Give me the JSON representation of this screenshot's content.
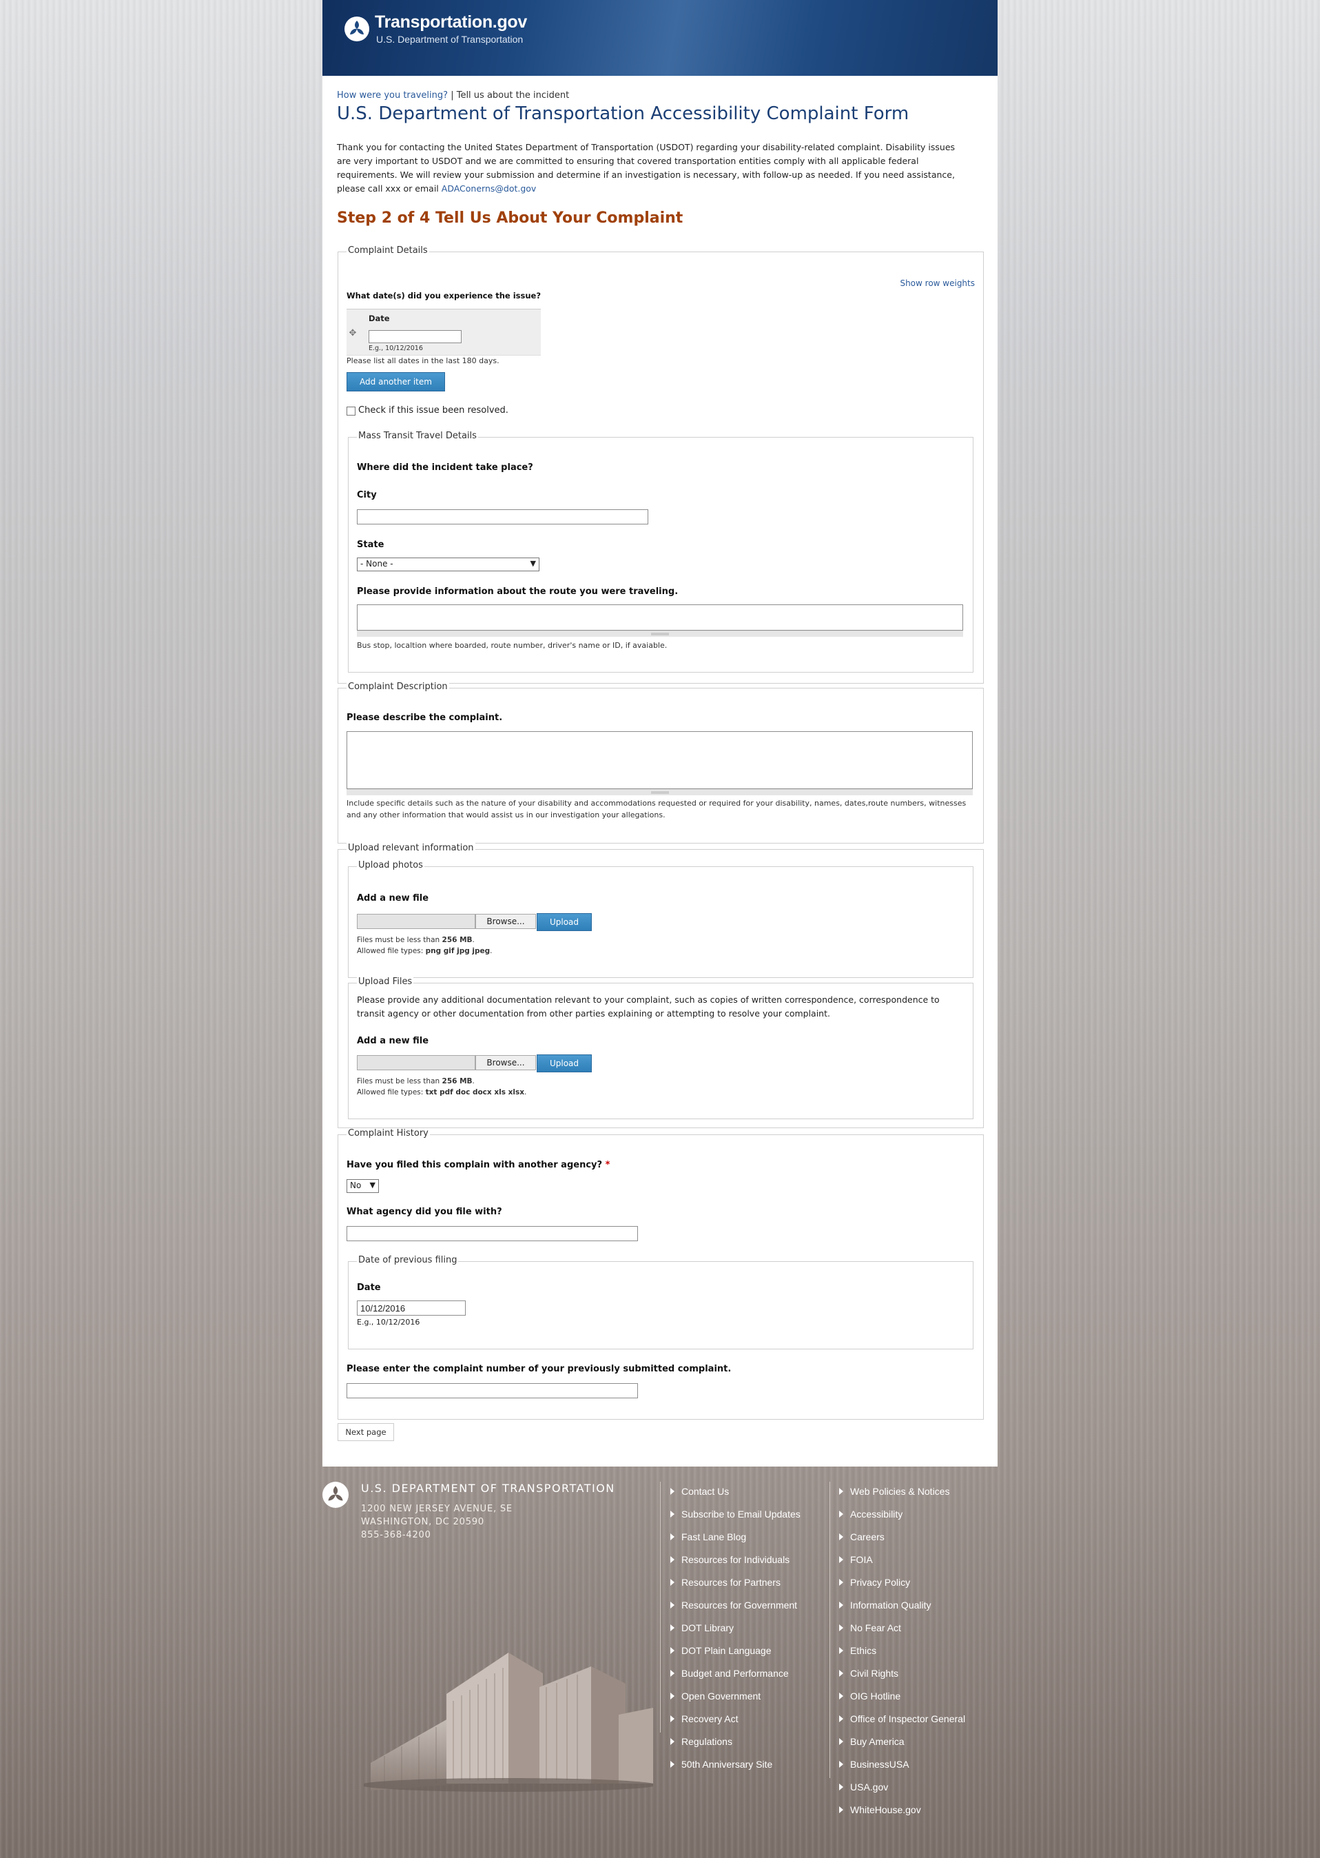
{
  "header": {
    "site_name": "Transportation.gov",
    "site_sub": "U.S. Department of Transportation"
  },
  "breadcrumb": {
    "link": "How were you traveling?",
    "separator": "|",
    "current": "Tell us about the incident"
  },
  "page_title": "U.S. Department of Transportation Accessibility Complaint Form",
  "intro": {
    "text": "Thank you for contacting the United States Department of Transportation (USDOT) regarding your disability-related complaint. Disability issues are very important to USDOT and we are committed to ensuring that covered transportation entities comply with all applicable federal requirements. We will review your submission and determine if an investigation is necessary, with follow-up as needed. If you need assistance, please call xxx or email ",
    "email": "ADAConerns@dot.gov"
  },
  "step_title": "Step 2 of 4 Tell Us About Your Complaint",
  "complaint_details": {
    "legend": "Complaint Details",
    "row_weights_link": "Show row weights",
    "dates_question": "What date(s) did you experience the issue?",
    "date_column": "Date",
    "date_value": "",
    "date_example": "E.g., 10/12/2016",
    "dates_hint": "Please list all dates in the last 180 days.",
    "add_another": "Add another item",
    "resolved_label": "Check if this issue been resolved.",
    "resolved_checked": false,
    "mass_transit": {
      "legend": "Mass Transit Travel Details",
      "where_question": "Where did the incident take place?",
      "city_label": "City",
      "city_value": "",
      "state_label": "State",
      "state_value": "- None -",
      "route_label": "Please provide information about the route you were traveling.",
      "route_value": "",
      "route_hint": "Bus stop, localtion where boarded, route number, driver's name or ID, if avaiable."
    }
  },
  "complaint_description": {
    "legend": "Complaint Description",
    "label": "Please describe the complaint.",
    "value": "",
    "hint": "Include specific details such as the nature of your disability and accommodations requested or required for your disability, names, dates,route numbers, witnesses and any other information that would assist us in our investigation your allegations."
  },
  "upload": {
    "legend": "Upload relevant information",
    "photos": {
      "legend": "Upload photos",
      "add_label": "Add a new file",
      "browse": "Browse...",
      "upload": "Upload",
      "size_prefix": "Files must be less than ",
      "size_value": "256 MB",
      "size_suffix": ".",
      "types_prefix": "Allowed file types: ",
      "types_value": "png gif jpg jpeg",
      "types_suffix": "."
    },
    "files": {
      "legend": "Upload Files",
      "description": "Please provide any additional documentation relevant to your complaint, such as copies of written correspondence, correspondence to transit agency or other documentation from other parties explaining or attempting to resolve your complaint.",
      "add_label": "Add a new file",
      "browse": "Browse...",
      "upload": "Upload",
      "size_prefix": "Files must be less than ",
      "size_value": "256 MB",
      "size_suffix": ".",
      "types_prefix": "Allowed file types: ",
      "types_value": "txt pdf doc docx xls xlsx",
      "types_suffix": "."
    }
  },
  "history": {
    "legend": "Complaint History",
    "filed_question": "Have you filed this complain with another agency?",
    "required_mark": "*",
    "filed_value": "No",
    "agency_label": "What agency did you file with?",
    "agency_value": "",
    "prev_filing_legend": "Date of previous filing",
    "date_label": "Date",
    "date_value": "10/12/2016",
    "date_example": "E.g., 10/12/2016",
    "complaint_number_label": "Please enter the complaint number of your previously submitted complaint.",
    "complaint_number_value": ""
  },
  "next_button": "Next page",
  "footer": {
    "title": "U.S. DEPARTMENT OF TRANSPORTATION",
    "address_line1": "1200 NEW JERSEY AVENUE, SE",
    "address_line2": "WASHINGTON, DC 20590",
    "phone": "855-368-4200",
    "links_col1": [
      "Contact Us",
      "Subscribe to Email Updates",
      "Fast Lane Blog",
      "Resources for Individuals",
      "Resources for Partners",
      "Resources for Government",
      "DOT Library",
      "DOT Plain Language",
      "Budget and Performance",
      "Open Government",
      "Recovery Act",
      "Regulations",
      "50th Anniversary Site"
    ],
    "links_col2": [
      "Web Policies & Notices",
      "Accessibility",
      "Careers",
      "FOIA",
      "Privacy Policy",
      "Information Quality",
      "No Fear Act",
      "Ethics",
      "Civil Rights",
      "OIG Hotline",
      "Office of Inspector General",
      "Buy America",
      "BusinessUSA",
      "USA.gov",
      "WhiteHouse.gov"
    ]
  },
  "colors": {
    "header_blue": "#1d4880",
    "title_blue": "#1b3f75",
    "step_orange": "#a0410c",
    "button_blue": "#2f7fb9",
    "required_red": "#cc0000"
  }
}
